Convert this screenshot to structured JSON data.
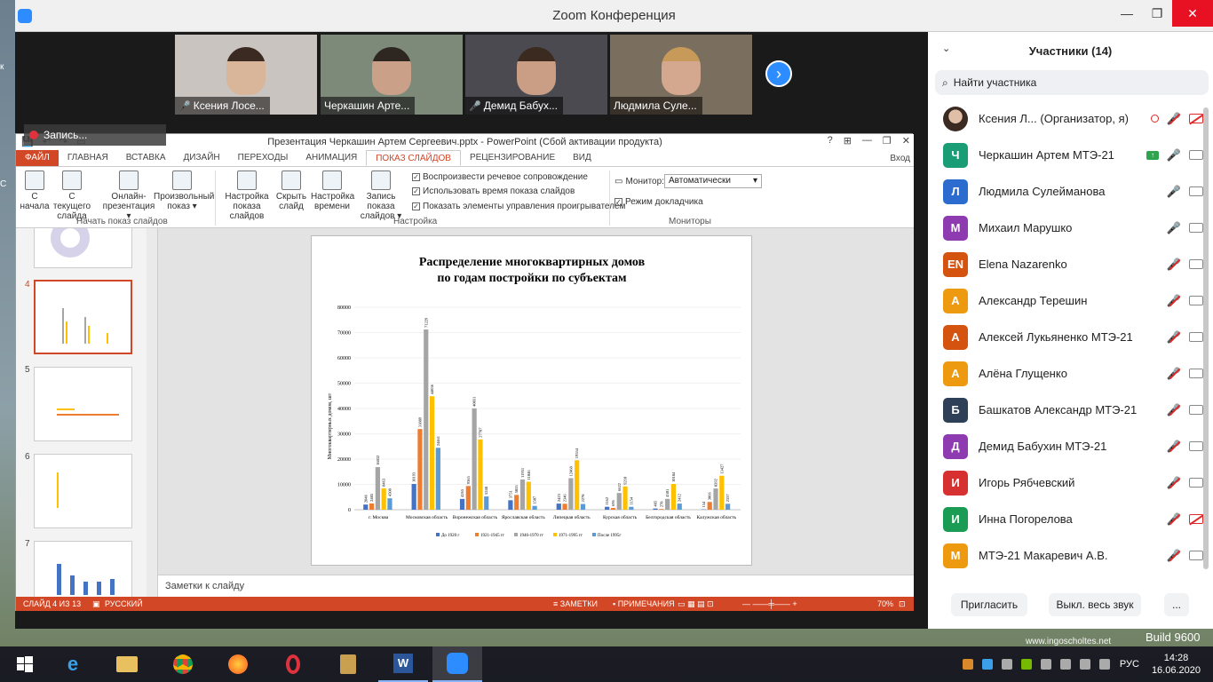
{
  "zoom": {
    "title": "Zoom Конференция",
    "window_controls": [
      "—",
      "❐",
      "✕"
    ]
  },
  "video_tiles": [
    {
      "name": "Ксения Лосе...",
      "muted": true,
      "skin": "#d9b59a",
      "hair": "#3b2a22",
      "bg": "#c9c4bf"
    },
    {
      "name": "Черкашин Арте...",
      "muted": false,
      "skin": "#caa088",
      "hair": "#2e2620",
      "bg": "#7d8a7a"
    },
    {
      "name": "Демид Бабух...",
      "muted": true,
      "skin": "#c99e84",
      "hair": "#3a2a20",
      "bg": "#4a4a50"
    },
    {
      "name": "Людмила Суле...",
      "muted": false,
      "skin": "#d4a88e",
      "hair": "#c89a5a",
      "bg": "#7a6e5e"
    }
  ],
  "recording": {
    "label": "Запись..."
  },
  "ppt": {
    "doc_title": "Презентация Черкашин Артем Сергеевич.pptx - PowerPoint (Сбой активации продукта)",
    "window_controls": [
      "?",
      "⊞",
      "—",
      "❐",
      "✕"
    ],
    "qat": [
      "💾",
      "↶",
      "↷",
      "▭"
    ],
    "tabs": [
      "ФАЙЛ",
      "ГЛАВНАЯ",
      "ВСТАВКА",
      "ДИЗАЙН",
      "ПЕРЕХОДЫ",
      "АНИМАЦИЯ",
      "ПОКАЗ СЛАЙДОВ",
      "РЕЦЕНЗИРОВАНИЕ",
      "ВИД"
    ],
    "login": "Вход",
    "ribbon": {
      "from_start": [
        "С",
        "начала"
      ],
      "from_current": [
        "С текущего",
        "слайда"
      ],
      "online": [
        "Онлайн-",
        "презентация ▾"
      ],
      "custom": [
        "Произвольный",
        "показ ▾"
      ],
      "group1": "Начать показ слайдов",
      "setup": [
        "Настройка",
        "показа слайдов"
      ],
      "hide": [
        "Скрыть",
        "слайд"
      ],
      "rehearse": [
        "Настройка",
        "времени"
      ],
      "record": [
        "Запись показа",
        "слайдов ▾"
      ],
      "chk1": "Воспроизвести речевое сопровождение",
      "chk2": "Использовать время показа слайдов",
      "chk3": "Показать элементы управления проигрывателем",
      "group2": "Настройка",
      "monitor_label": "Монитор:",
      "monitor_value": "Автоматически",
      "presenter_view": "Режим докладчика",
      "group3": "Мониторы"
    },
    "thumb_numbers": [
      "4",
      "5",
      "6",
      "7"
    ],
    "notes_placeholder": "Заметки к слайду",
    "status": {
      "slide": "СЛАЙД 4 ИЗ 13",
      "lang": "РУССКИЙ",
      "notes": "ЗАМЕТКИ",
      "comments": "ПРИМЕЧАНИЯ",
      "zoom": "70%"
    }
  },
  "chart_data": {
    "type": "bar",
    "title_line1": "Распределение многоквартирных домов",
    "title_line2": "по годам постройки по субъектам",
    "ylabel": "Многоквартирных домов, шт",
    "ylim": [
      0,
      80000
    ],
    "yticks": [
      "0",
      "10000",
      "20000",
      "30000",
      "40000",
      "50000",
      "60000",
      "70000",
      "80000"
    ],
    "categories": [
      "г. Москва",
      "Московская область",
      "Воронежская область",
      "Ярославская область",
      "Липецкая область",
      "Курская область",
      "Белгородская область",
      "Калужская область"
    ],
    "series": [
      {
        "name": "До 1920 г",
        "color": "#4472c4",
        "values": [
          2046,
          10193,
          4265,
          3751,
          2423,
          1162,
          485,
          154
        ]
      },
      {
        "name": "1921-1945 гг",
        "color": "#ed7d31",
        "values": [
          2485,
          31889,
          9365,
          5855,
          2346,
          696,
          278,
          3066
        ]
      },
      {
        "name": "1946-1970 гг",
        "color": "#a5a5a5",
        "values": [
          16832,
          71229,
          40031,
          11951,
          12468,
          6622,
          4301,
          8392
        ]
      },
      {
        "name": "1971-1995 гг",
        "color": "#ffc000",
        "values": [
          8463,
          44836,
          27787,
          11046,
          19554,
          9210,
          10184,
          13427
        ]
      },
      {
        "name": "После 1995г",
        "color": "#5b9bd5",
        "values": [
          4508,
          24461,
          5248,
          1507,
          2278,
          1154,
          2412,
          2337
        ]
      }
    ]
  },
  "participants": {
    "title": "Участники (14)",
    "search_placeholder": "Найти участника",
    "list": [
      {
        "name": "Ксения Л...  (Организатор, я)",
        "initial": "",
        "color": "#b48b72",
        "mic": "muted",
        "cam": "off",
        "photo": true,
        "host": true
      },
      {
        "name": "Черкашин Артем МТЭ-21",
        "initial": "Ч",
        "color": "#1a9c74",
        "mic": "on",
        "cam": "on",
        "share": true
      },
      {
        "name": "Людмила Сулейманова",
        "initial": "Л",
        "color": "#2d6ccf",
        "mic": "on",
        "cam": "on"
      },
      {
        "name": "Михаил Марушко",
        "initial": "М",
        "color": "#8e3ab0",
        "mic": "on",
        "cam": "on"
      },
      {
        "name": "Elena Nazarenko",
        "initial": "EN",
        "color": "#d4530f",
        "mic": "muted",
        "cam": "on"
      },
      {
        "name": "Александр Терешин",
        "initial": "А",
        "color": "#ee9a10",
        "mic": "muted",
        "cam": "on"
      },
      {
        "name": "Алексей Лукьяненко МТЭ-21",
        "initial": "А",
        "color": "#d4530f",
        "mic": "muted",
        "cam": "on"
      },
      {
        "name": "Алёна Глущенко",
        "initial": "А",
        "color": "#ee9a10",
        "mic": "muted",
        "cam": "on"
      },
      {
        "name": "Башкатов Александр МТЭ-21",
        "initial": "Б",
        "color": "#2e4057",
        "mic": "muted",
        "cam": "on"
      },
      {
        "name": "Демид Бабухин МТЭ-21",
        "initial": "Д",
        "color": "#8e3ab0",
        "mic": "muted",
        "cam": "on"
      },
      {
        "name": "Игорь Рябчевский",
        "initial": "И",
        "color": "#d63030",
        "mic": "muted",
        "cam": "on"
      },
      {
        "name": "Инна Погорелова",
        "initial": "И",
        "color": "#1a9c55",
        "mic": "muted",
        "cam": "off"
      },
      {
        "name": "МТЭ-21 Макаревич А.В.",
        "initial": "М",
        "color": "#ee9a10",
        "mic": "muted",
        "cam": "on"
      }
    ],
    "invite": "Пригласить",
    "mute_all": "Выкл. весь звук",
    "more": "..."
  },
  "desktop": {
    "watermark": "www.ingoscholtes.net",
    "build": "Build 9600"
  },
  "taskbar": {
    "apps": [
      "windows-start",
      "internet-explorer",
      "file-explorer",
      "chrome",
      "firefox",
      "opera",
      "archive",
      "word",
      "zoom"
    ],
    "lang": "РУС",
    "time": "14:28",
    "date": "16.06.2020"
  }
}
